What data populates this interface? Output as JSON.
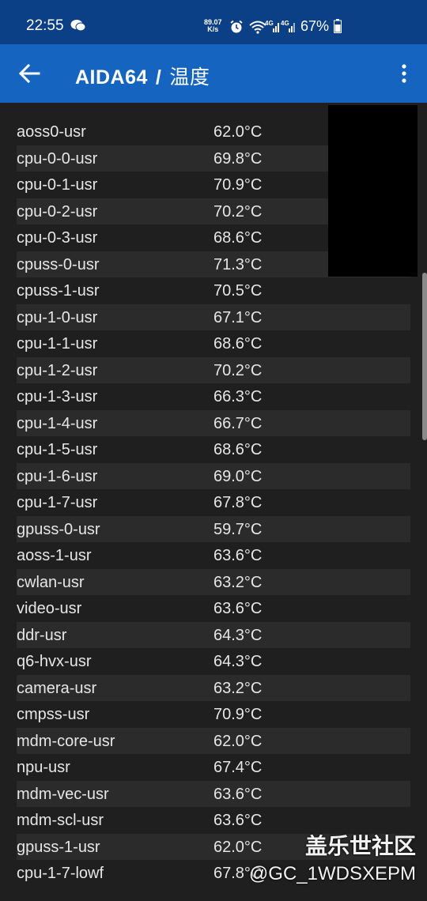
{
  "status": {
    "time": "22:55",
    "speed_top": "89.07",
    "speed_bottom": "K/s",
    "battery": "67%",
    "icons": [
      "wechat-icon",
      "alarm-icon",
      "wifi-icon",
      "signal-4g-icon",
      "signal-4g-icon",
      "battery-icon"
    ]
  },
  "appbar": {
    "title": "AIDA64",
    "separator": "/",
    "subtitle": "温度",
    "icons": [
      "back-arrow-icon",
      "more-vert-icon"
    ]
  },
  "rows": [
    {
      "name": "aoss0-usr",
      "value": "62.0°C"
    },
    {
      "name": "cpu-0-0-usr",
      "value": "69.8°C"
    },
    {
      "name": "cpu-0-1-usr",
      "value": "70.9°C"
    },
    {
      "name": "cpu-0-2-usr",
      "value": "70.2°C"
    },
    {
      "name": "cpu-0-3-usr",
      "value": "68.6°C"
    },
    {
      "name": "cpuss-0-usr",
      "value": "71.3°C"
    },
    {
      "name": "cpuss-1-usr",
      "value": "70.5°C"
    },
    {
      "name": "cpu-1-0-usr",
      "value": "67.1°C"
    },
    {
      "name": "cpu-1-1-usr",
      "value": "68.6°C"
    },
    {
      "name": "cpu-1-2-usr",
      "value": "70.2°C"
    },
    {
      "name": "cpu-1-3-usr",
      "value": "66.3°C"
    },
    {
      "name": "cpu-1-4-usr",
      "value": "66.7°C"
    },
    {
      "name": "cpu-1-5-usr",
      "value": "68.6°C"
    },
    {
      "name": "cpu-1-6-usr",
      "value": "69.0°C"
    },
    {
      "name": "cpu-1-7-usr",
      "value": "67.8°C"
    },
    {
      "name": "gpuss-0-usr",
      "value": "59.7°C"
    },
    {
      "name": "aoss-1-usr",
      "value": "63.6°C"
    },
    {
      "name": "cwlan-usr",
      "value": "63.2°C"
    },
    {
      "name": "video-usr",
      "value": "63.6°C"
    },
    {
      "name": "ddr-usr",
      "value": "64.3°C"
    },
    {
      "name": "q6-hvx-usr",
      "value": "64.3°C"
    },
    {
      "name": "camera-usr",
      "value": "63.2°C"
    },
    {
      "name": "cmpss-usr",
      "value": "70.9°C"
    },
    {
      "name": "mdm-core-usr",
      "value": "62.0°C"
    },
    {
      "name": "npu-usr",
      "value": "67.4°C"
    },
    {
      "name": "mdm-vec-usr",
      "value": "63.6°C"
    },
    {
      "name": "mdm-scl-usr",
      "value": "63.6°C"
    },
    {
      "name": "gpuss-1-usr",
      "value": "62.0°C"
    },
    {
      "name": "cpu-1-7-lowf",
      "value": "67.8°C"
    }
  ],
  "watermark": {
    "line1": "盖乐世社区",
    "line2": "@GC_1WDSXEPM"
  },
  "colors": {
    "statusbar": "#0b3f86",
    "appbar": "#1565c0",
    "background": "#1f1f1f",
    "row_alt": "#2b2b2b",
    "text": "#e6e6e6"
  }
}
